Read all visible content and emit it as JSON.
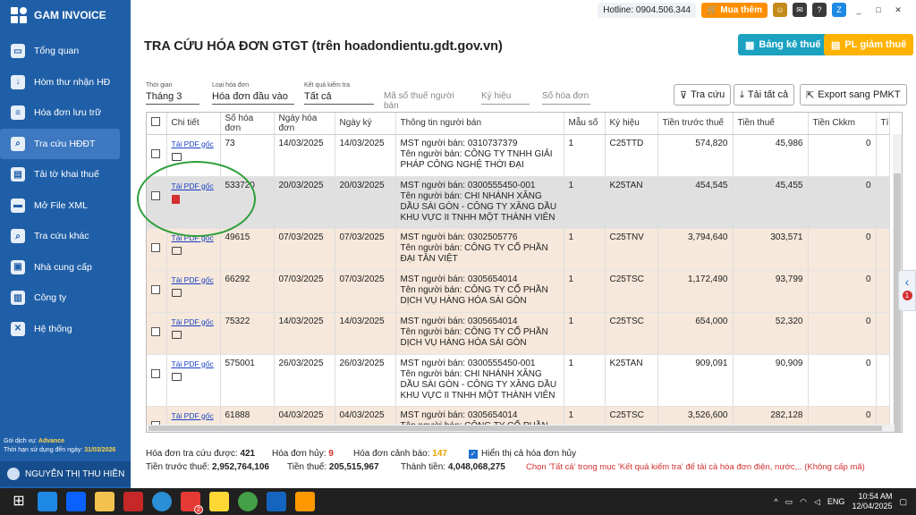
{
  "app": {
    "name": "GAM INVOICE"
  },
  "sidebar": {
    "items": [
      {
        "label": "Tổng quan",
        "icon": "monitor-icon"
      },
      {
        "label": "Hòm thư nhận HĐ",
        "icon": "download-icon"
      },
      {
        "label": "Hóa đơn lưu trữ",
        "icon": "document-icon"
      },
      {
        "label": "Tra cứu HĐĐT",
        "icon": "lookup-icon",
        "active": true
      },
      {
        "label": "Tải tờ khai thuế",
        "icon": "form-icon"
      },
      {
        "label": "Mở File XML",
        "icon": "folder-icon"
      },
      {
        "label": "Tra cứu khác",
        "icon": "search-icon"
      },
      {
        "label": "Nhà cung cấp",
        "icon": "id-card-icon"
      },
      {
        "label": "Công ty",
        "icon": "building-icon"
      },
      {
        "label": "Hệ thống",
        "icon": "tools-icon"
      }
    ],
    "service_label": "Gói dịch vụ:",
    "service_value": "Advance",
    "expiry_label": "Thời hạn sử dụng đến ngày:",
    "expiry_value": "31/03/2026",
    "user": "NGUYỄN THỊ THU HIỀN"
  },
  "topbar": {
    "hotline": "Hotline: 0904.506.344",
    "buy": "Mua thêm"
  },
  "page": {
    "title": "TRA CỨU HÓA ĐƠN GTGT (trên hoadondientu.gdt.gov.vn)",
    "btn_bangke": "Bảng kê thuế",
    "btn_giamthue": "PL giảm thuế"
  },
  "filters": {
    "period_label": "Thời gian",
    "period": "Tháng 3",
    "type_label": "Loại hóa đơn",
    "type": "Hóa đơn đầu vào",
    "result_label": "Kết quả kiểm tra",
    "result": "Tất cả",
    "mst_placeholder": "Mã số thuế người bán",
    "symbol_placeholder": "Ký hiệu",
    "number_placeholder": "Số hóa đơn",
    "btn_search": "Tra cứu",
    "btn_download_all": "Tải tất cả",
    "btn_export": "Export sang PMKT"
  },
  "table": {
    "headers": [
      "",
      "Chi tiết",
      "Số hóa đơn",
      "Ngày hóa đơn",
      "Ngày ký",
      "Thông tin người bán",
      "Mẫu số",
      "Ký hiệu",
      "Tiền trước thuế",
      "Tiền thuế",
      "Tiền Ckkm",
      "Tí"
    ],
    "pdf_label": "Tải PDF gốc",
    "rows": [
      {
        "so": "73",
        "ngay_hd": "14/03/2025",
        "ngay_ky": "14/03/2025",
        "mst": "MST người bán: 0310737379",
        "ten": "Tên người bán: CÔNG TY TNHH GIẢI PHÁP CÔNG NGHỆ THỜI ĐẠI",
        "mau": "1",
        "ky_hieu": "C25TTD",
        "truoc_thue": "574,820",
        "thue": "45,986",
        "ckkm": "0",
        "style": "white"
      },
      {
        "so": "533720",
        "ngay_hd": "20/03/2025",
        "ngay_ky": "20/03/2025",
        "mst": "MST người bán: 0300555450-001",
        "ten": "Tên người bán: CHI NHÁNH XĂNG DẦU SÀI GÒN - CÔNG TY XĂNG DẦU KHU VỰC II TNHH MỘT THÀNH VIÊN",
        "mau": "1",
        "ky_hieu": "K25TAN",
        "truoc_thue": "454,545",
        "thue": "45,455",
        "ckkm": "0",
        "style": "sel"
      },
      {
        "so": "49615",
        "ngay_hd": "07/03/2025",
        "ngay_ky": "07/03/2025",
        "mst": "MST người bán: 0302505776",
        "ten": "Tên người bán: CÔNG TY CỔ PHẦN ĐẠI TÂN VIỆT",
        "mau": "1",
        "ky_hieu": "C25TNV",
        "truoc_thue": "3,794,640",
        "thue": "303,571",
        "ckkm": "0",
        "style": "tan"
      },
      {
        "so": "66292",
        "ngay_hd": "07/03/2025",
        "ngay_ky": "07/03/2025",
        "mst": "MST người bán: 0305654014",
        "ten": "Tên người bán: CÔNG TY CỔ PHẦN DỊCH VỤ HÀNG HÓA SÀI GÒN",
        "mau": "1",
        "ky_hieu": "C25TSC",
        "truoc_thue": "1,172,490",
        "thue": "93,799",
        "ckkm": "0",
        "style": "tan"
      },
      {
        "so": "75322",
        "ngay_hd": "14/03/2025",
        "ngay_ky": "14/03/2025",
        "mst": "MST người bán: 0305654014",
        "ten": "Tên người bán: CÔNG TY CỔ PHẦN DỊCH VỤ HÀNG HÓA SÀI GÒN",
        "mau": "1",
        "ky_hieu": "C25TSC",
        "truoc_thue": "654,000",
        "thue": "52,320",
        "ckkm": "0",
        "style": "tan"
      },
      {
        "so": "575001",
        "ngay_hd": "26/03/2025",
        "ngay_ky": "26/03/2025",
        "mst": "MST người bán: 0300555450-001",
        "ten": "Tên người bán: CHI NHÁNH XĂNG DẦU SÀI GÒN - CÔNG TY XĂNG DẦU KHU VỰC II TNHH MỘT THÀNH VIÊN",
        "mau": "1",
        "ky_hieu": "K25TAN",
        "truoc_thue": "909,091",
        "thue": "90,909",
        "ckkm": "0",
        "style": "white"
      },
      {
        "so": "61888",
        "ngay_hd": "04/03/2025",
        "ngay_ky": "04/03/2025",
        "mst": "MST người bán: 0305654014",
        "ten": "Tên người bán: CÔNG TY CỔ PHẦN DỊCH VỤ HÀNG HÓA SÀI GÒN",
        "mau": "1",
        "ky_hieu": "C25TSC",
        "truoc_thue": "3,526,600",
        "thue": "282,128",
        "ckkm": "0",
        "style": "tan"
      }
    ]
  },
  "footer": {
    "found_label": "Hóa đơn tra cứu được:",
    "found": "421",
    "cancel_label": "Hóa đơn hủy:",
    "cancel": "9",
    "warn_label": "Hóa đơn cảnh báo:",
    "warn": "147",
    "show_cancel": "Hiển thị cả hóa đơn hủy",
    "pre_tax_label": "Tiền trước thuế:",
    "pre_tax": "2,952,764,106",
    "tax_label": "Tiền thuế:",
    "tax": "205,515,967",
    "total_label": "Thành tiền:",
    "total": "4,048,068,275",
    "note": "Chọn 'Tất cả' trong mục 'Kết quả kiểm tra' để tải cả hóa đơn điện, nước,.. (Không cấp mã)"
  },
  "side_tab": {
    "badge": "1"
  },
  "taskbar": {
    "lang": "ENG",
    "time": "10:54 AM",
    "date": "12/04/2025",
    "mail_badge": "2"
  },
  "colors": {
    "sidebar": "#1f5fa8",
    "accent_teal": "#1aa2c0",
    "accent_amber": "#ffb300",
    "row_tan": "#f6e8da",
    "row_selected": "#e0e0e0",
    "warn_red": "#d32f2f"
  }
}
